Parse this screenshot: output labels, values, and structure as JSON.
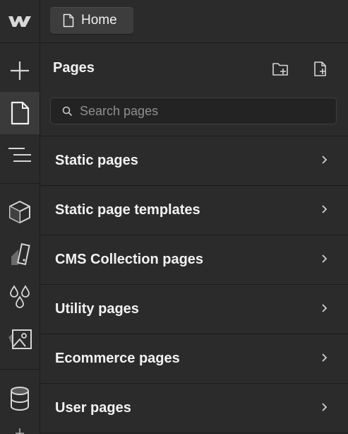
{
  "rail": {
    "logo_icon": "webflow-logo-icon",
    "items": [
      {
        "name": "add-panel-button",
        "icon": "plus-icon"
      },
      {
        "name": "pages-panel-button",
        "icon": "page-icon",
        "active": true
      },
      {
        "name": "navigator-panel-button",
        "icon": "navigator-icon"
      },
      {
        "name": "components-panel-button",
        "icon": "cube-icon"
      },
      {
        "name": "style-selectors-panel-button",
        "icon": "brush-icon"
      },
      {
        "name": "variables-panel-button",
        "icon": "drops-icon"
      },
      {
        "name": "assets-panel-button",
        "icon": "image-icon"
      },
      {
        "name": "cms-panel-button",
        "icon": "database-icon"
      }
    ]
  },
  "topbar": {
    "home_label": "Home",
    "home_icon": "page-icon"
  },
  "panel": {
    "title": "Pages",
    "new_folder_icon": "folder-plus-icon",
    "new_page_icon": "page-plus-icon"
  },
  "search": {
    "placeholder": "Search pages",
    "value": ""
  },
  "sections": [
    {
      "label": "Static pages"
    },
    {
      "label": "Static page templates"
    },
    {
      "label": "CMS Collection pages"
    },
    {
      "label": "Utility pages"
    },
    {
      "label": "Ecommerce pages"
    },
    {
      "label": "User pages"
    }
  ],
  "colors": {
    "background": "#2b2b2b",
    "active_rail": "#3a3a3a",
    "text": "#f2f2f2",
    "muted": "#8f8f8f"
  }
}
